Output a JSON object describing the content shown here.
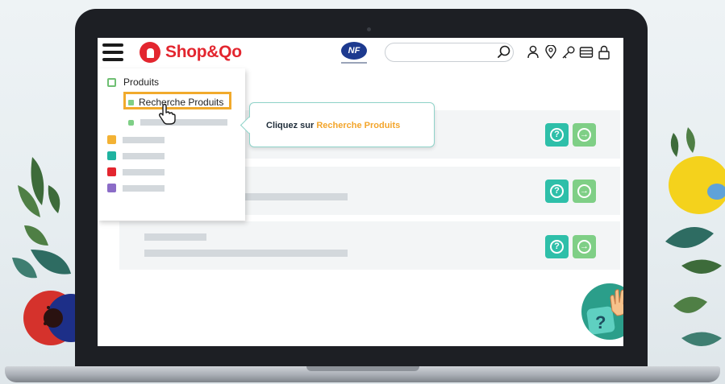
{
  "brand": {
    "name": "Shop&Qo",
    "cert_badge": "NF",
    "brand_color": "#e3262f"
  },
  "search": {
    "placeholder": "",
    "value": ""
  },
  "header_icons": [
    "user-icon",
    "location-pin-icon",
    "key-icon",
    "wallet-icon",
    "lock-icon"
  ],
  "menu": {
    "section_label": "Produits",
    "highlighted_item": "Recherche Produits"
  },
  "tooltip": {
    "prefix": "Cliquez sur ",
    "highlight": "Recherche Produits",
    "highlight_color": "#f3a52b"
  },
  "colors": {
    "help_button": "#2ebfa9",
    "go_button": "#7fcf86",
    "highlight_border": "#f1aa2c",
    "tooltip_border": "#8fd3c9"
  },
  "cards": [
    {
      "help_icon": "question-icon",
      "go_icon": "arrow-right-icon"
    },
    {
      "help_icon": "question-icon",
      "go_icon": "arrow-right-icon"
    },
    {
      "help_icon": "question-icon",
      "go_icon": "arrow-right-icon"
    }
  ]
}
